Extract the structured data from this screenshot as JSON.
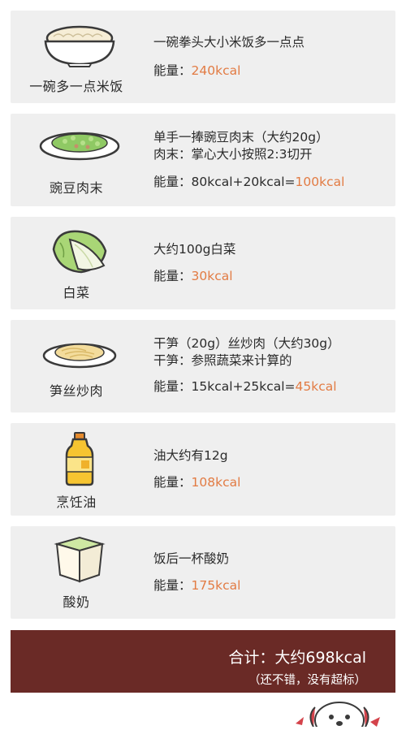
{
  "items": [
    {
      "name": "一碗多一点米饭",
      "icon": "rice-bowl-icon",
      "desc": [
        "一碗拳头大小米饭多一点点"
      ],
      "energy_label": "能量：",
      "energy_prefix": "",
      "energy_value": "240kcal"
    },
    {
      "name": "豌豆肉末",
      "icon": "peas-minced-meat-icon",
      "desc": [
        "单手一捧豌豆肉末（大约20g）",
        "肉末：掌心大小按照2:3切开"
      ],
      "energy_label": "能量：",
      "energy_prefix": "80kcal+20kcal=",
      "energy_value": "100kcal"
    },
    {
      "name": "白菜",
      "icon": "cabbage-icon",
      "desc": [
        "大约100g白菜"
      ],
      "energy_label": "能量：",
      "energy_prefix": "",
      "energy_value": "30kcal"
    },
    {
      "name": "笋丝炒肉",
      "icon": "shredded-bamboo-pork-icon",
      "desc": [
        "干笋（20g）丝炒肉（大约30g）",
        "干笋：参照蔬菜来计算的"
      ],
      "energy_label": "能量：",
      "energy_prefix": "15kcal+25kcal=",
      "energy_value": "45kcal"
    },
    {
      "name": "烹饪油",
      "icon": "oil-bottle-icon",
      "desc": [
        "油大约有12g"
      ],
      "energy_label": "能量：",
      "energy_prefix": "",
      "energy_value": "108kcal"
    },
    {
      "name": "酸奶",
      "icon": "yogurt-cup-icon",
      "desc": [
        "饭后一杯酸奶"
      ],
      "energy_label": "能量：",
      "energy_prefix": "",
      "energy_value": "175kcal"
    }
  ],
  "total": {
    "main": "合计：大约698kcal",
    "sub": "（还不错，没有超标）"
  },
  "colors": {
    "card_bg": "#efefef",
    "highlight": "#e27b43",
    "total_bg": "#6a2a26"
  }
}
